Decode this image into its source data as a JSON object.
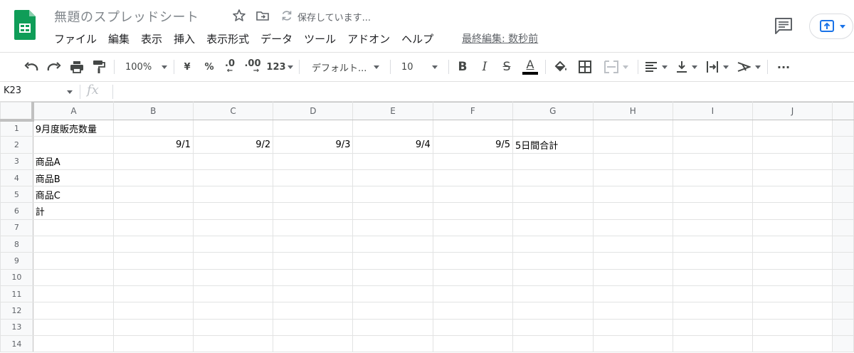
{
  "app": {
    "doc_title": "無題のスプレッドシート",
    "save_status": "保存しています...",
    "last_edit": "最終編集: 数秒前",
    "brand_color": "#0f9d58",
    "accent_color": "#1a73e8"
  },
  "menu": [
    "ファイル",
    "編集",
    "表示",
    "挿入",
    "表示形式",
    "データ",
    "ツール",
    "アドオン",
    "ヘルプ"
  ],
  "toolbar": {
    "zoom": "100%",
    "currency": "¥",
    "percent": "%",
    "decimal_decrease": ".0",
    "decimal_increase": ".00",
    "more_formats": "123",
    "font_family": "デフォルト...",
    "font_size": "10",
    "bold": "B",
    "italic": "I",
    "strikethrough": "S",
    "text_color_letter": "A",
    "more": "···"
  },
  "formula_bar": {
    "cell_ref": "K23",
    "fx": "fx",
    "content": ""
  },
  "sheet": {
    "columns": [
      "A",
      "B",
      "C",
      "D",
      "E",
      "F",
      "G",
      "H",
      "I",
      "J"
    ],
    "rows": [
      {
        "num": "1",
        "cells": [
          "9月度販売数量",
          "",
          "",
          "",
          "",
          "",
          "",
          "",
          "",
          ""
        ]
      },
      {
        "num": "2",
        "cells": [
          "",
          "9/1",
          "9/2",
          "9/3",
          "9/4",
          "9/5",
          "5日間合計",
          "",
          "",
          ""
        ]
      },
      {
        "num": "3",
        "cells": [
          "商品A",
          "",
          "",
          "",
          "",
          "",
          "",
          "",
          "",
          ""
        ]
      },
      {
        "num": "4",
        "cells": [
          "商品B",
          "",
          "",
          "",
          "",
          "",
          "",
          "",
          "",
          ""
        ]
      },
      {
        "num": "5",
        "cells": [
          "商品C",
          "",
          "",
          "",
          "",
          "",
          "",
          "",
          "",
          ""
        ]
      },
      {
        "num": "6",
        "cells": [
          "計",
          "",
          "",
          "",
          "",
          "",
          "",
          "",
          "",
          ""
        ]
      },
      {
        "num": "7",
        "cells": [
          "",
          "",
          "",
          "",
          "",
          "",
          "",
          "",
          "",
          ""
        ]
      },
      {
        "num": "8",
        "cells": [
          "",
          "",
          "",
          "",
          "",
          "",
          "",
          "",
          "",
          ""
        ]
      },
      {
        "num": "9",
        "cells": [
          "",
          "",
          "",
          "",
          "",
          "",
          "",
          "",
          "",
          ""
        ]
      },
      {
        "num": "10",
        "cells": [
          "",
          "",
          "",
          "",
          "",
          "",
          "",
          "",
          "",
          ""
        ]
      },
      {
        "num": "11",
        "cells": [
          "",
          "",
          "",
          "",
          "",
          "",
          "",
          "",
          "",
          ""
        ]
      },
      {
        "num": "12",
        "cells": [
          "",
          "",
          "",
          "",
          "",
          "",
          "",
          "",
          "",
          ""
        ]
      },
      {
        "num": "13",
        "cells": [
          "",
          "",
          "",
          "",
          "",
          "",
          "",
          "",
          "",
          ""
        ]
      },
      {
        "num": "14",
        "cells": [
          "",
          "",
          "",
          "",
          "",
          "",
          "",
          "",
          "",
          ""
        ]
      }
    ],
    "right_aligned": [
      [
        "2",
        "1"
      ],
      [
        "2",
        "2"
      ],
      [
        "2",
        "3"
      ],
      [
        "2",
        "4"
      ],
      [
        "2",
        "5"
      ]
    ]
  }
}
